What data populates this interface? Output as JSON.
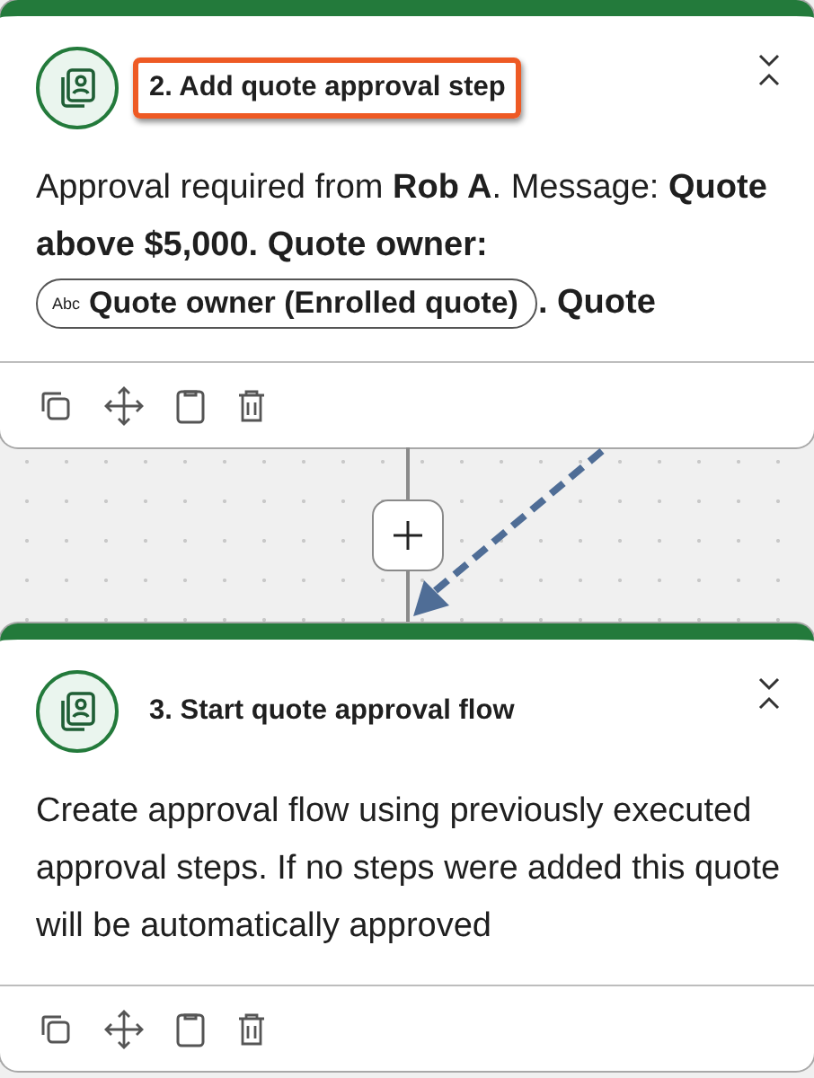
{
  "steps": [
    {
      "title": "2. Add quote approval step",
      "highlighted": true,
      "description": [
        {
          "kind": "text",
          "text": "Approval required from **Rob A**. Message: **Quote above $5,000. Quote owner:** "
        },
        {
          "kind": "token",
          "type_label": "Abc",
          "label": "Quote owner (Enrolled quote)"
        },
        {
          "kind": "text",
          "text": "**. Quote**"
        }
      ]
    },
    {
      "title": "3. Start quote approval flow",
      "highlighted": false,
      "description": [
        {
          "kind": "text",
          "text": "Create approval flow using previously executed approval steps. If no steps were added this quote will be automatically approved"
        }
      ]
    }
  ]
}
